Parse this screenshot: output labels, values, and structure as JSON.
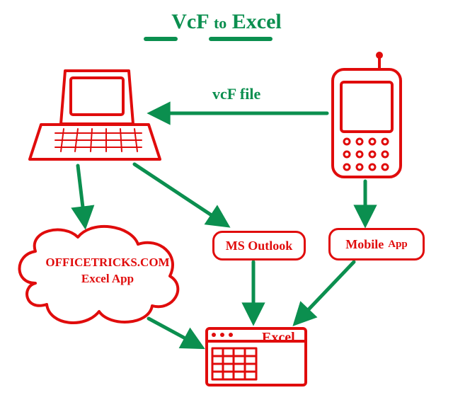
{
  "title_part1": "VcF",
  "title_mid": "to",
  "title_part2": "Excel",
  "arrow_label_top": "vcF file",
  "nodes": {
    "laptop": "laptop",
    "phone": "phone",
    "cloud_line1": "OFFICETRICKS.COM",
    "cloud_line2": "Excel App",
    "outlook": "MS Outlook",
    "mobile_app_word1": "Mobile",
    "mobile_app_word2": "App",
    "excel": "Excel"
  },
  "colors": {
    "ink_red": "#e00c0c",
    "ink_green": "#0b8f4f"
  }
}
